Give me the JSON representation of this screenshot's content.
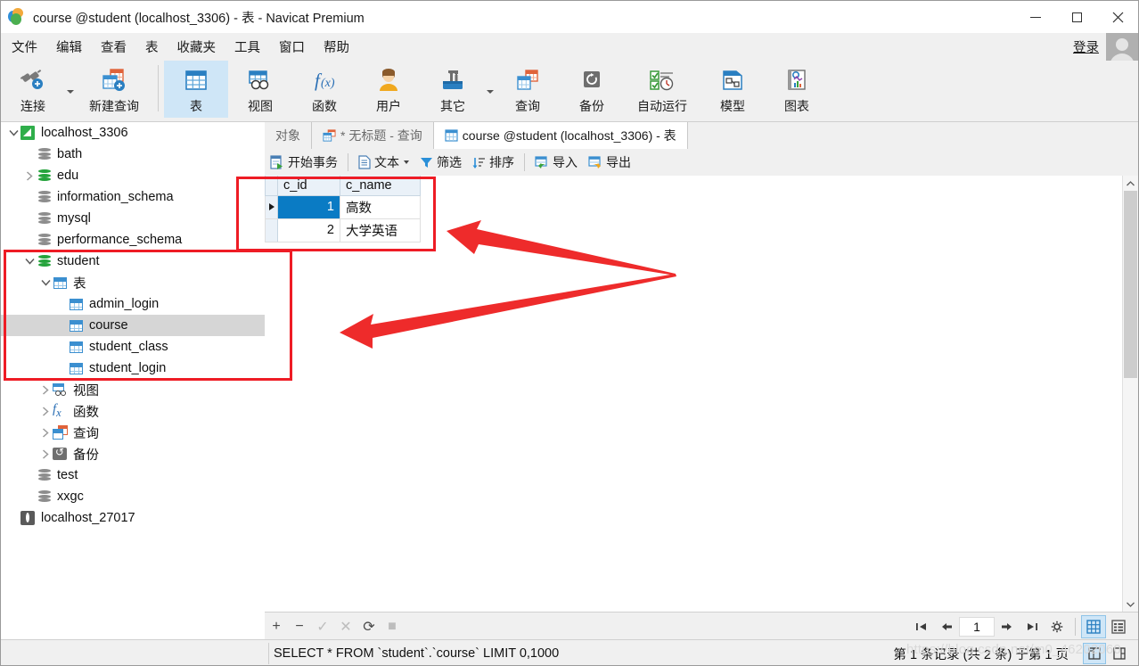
{
  "window": {
    "title": "course @student (localhost_3306) - 表 - Navicat Premium",
    "app_icon": "navicat-logo-icon",
    "controls": {
      "minimize": "minimize-icon",
      "maximize": "maximize-icon",
      "close": "close-icon"
    }
  },
  "menubar": {
    "items": [
      "文件",
      "编辑",
      "查看",
      "表",
      "收藏夹",
      "工具",
      "窗口",
      "帮助"
    ],
    "login_label": "登录",
    "avatar": "user-avatar-icon"
  },
  "ribbon": {
    "buttons": [
      {
        "label": "连接",
        "icon": "connection-icon",
        "has_caret": true,
        "selected": false
      },
      {
        "label": "新建查询",
        "icon": "new-query-icon",
        "has_caret": false,
        "selected": false
      },
      {
        "label": "表",
        "icon": "table-icon",
        "has_caret": false,
        "selected": true
      },
      {
        "label": "视图",
        "icon": "view-icon",
        "has_caret": false,
        "selected": false
      },
      {
        "label": "函数",
        "icon": "function-fx-icon",
        "has_caret": false,
        "selected": false
      },
      {
        "label": "用户",
        "icon": "user-icon",
        "has_caret": false,
        "selected": false
      },
      {
        "label": "其它",
        "icon": "others-toolbox-icon",
        "has_caret": true,
        "selected": false
      },
      {
        "label": "查询",
        "icon": "query-icon",
        "has_caret": false,
        "selected": false
      },
      {
        "label": "备份",
        "icon": "backup-icon",
        "has_caret": false,
        "selected": false
      },
      {
        "label": "自动运行",
        "icon": "automation-icon",
        "has_caret": false,
        "selected": false
      },
      {
        "label": "模型",
        "icon": "model-icon",
        "has_caret": false,
        "selected": false
      },
      {
        "label": "图表",
        "icon": "chart-icon",
        "has_caret": false,
        "selected": false
      }
    ]
  },
  "sidebar": {
    "items": [
      {
        "label": "localhost_3306",
        "indent": 0,
        "twisty": "down",
        "icon": "server-mysql-icon",
        "active": false
      },
      {
        "label": "bath",
        "indent": 1,
        "twisty": "none",
        "icon": "database-gray-icon",
        "active": false
      },
      {
        "label": "edu",
        "indent": 1,
        "twisty": "right",
        "icon": "database-green-icon",
        "active": false
      },
      {
        "label": "information_schema",
        "indent": 1,
        "twisty": "none",
        "icon": "database-gray-icon",
        "active": false
      },
      {
        "label": "mysql",
        "indent": 1,
        "twisty": "none",
        "icon": "database-gray-icon",
        "active": false
      },
      {
        "label": "performance_schema",
        "indent": 1,
        "twisty": "none",
        "icon": "database-gray-icon",
        "active": false
      },
      {
        "label": "student",
        "indent": 1,
        "twisty": "down",
        "icon": "database-green-icon",
        "active": false
      },
      {
        "label": "表",
        "indent": 2,
        "twisty": "down",
        "icon": "table-folder-icon",
        "active": false
      },
      {
        "label": "admin_login",
        "indent": 3,
        "twisty": "none",
        "icon": "table-icon",
        "active": false
      },
      {
        "label": "course",
        "indent": 3,
        "twisty": "none",
        "icon": "table-icon",
        "active": true
      },
      {
        "label": "student_class",
        "indent": 3,
        "twisty": "none",
        "icon": "table-icon",
        "active": false
      },
      {
        "label": "student_login",
        "indent": 3,
        "twisty": "none",
        "icon": "table-icon",
        "active": false
      },
      {
        "label": "视图",
        "indent": 2,
        "twisty": "right",
        "icon": "view-folder-icon",
        "active": false
      },
      {
        "label": "函数",
        "indent": 2,
        "twisty": "right",
        "icon": "function-fx-icon",
        "active": false
      },
      {
        "label": "查询",
        "indent": 2,
        "twisty": "right",
        "icon": "query-folder-icon",
        "active": false
      },
      {
        "label": "备份",
        "indent": 2,
        "twisty": "right",
        "icon": "backup-folder-icon",
        "active": false
      },
      {
        "label": "test",
        "indent": 1,
        "twisty": "none",
        "icon": "database-gray-icon",
        "active": false
      },
      {
        "label": "xxgc",
        "indent": 1,
        "twisty": "none",
        "icon": "database-gray-icon",
        "active": false
      },
      {
        "label": "localhost_27017",
        "indent": 0,
        "twisty": "none",
        "icon": "server-mongodb-icon",
        "active": false
      }
    ]
  },
  "tabs": [
    {
      "label": "对象",
      "icon": "",
      "active": false
    },
    {
      "label": "* 无标题 - 查询",
      "icon": "query-icon",
      "active": false
    },
    {
      "label": "course @student (localhost_3306) - 表",
      "icon": "table-icon",
      "active": true
    }
  ],
  "grid_toolbar": [
    {
      "label": "开始事务",
      "icon": "transaction-icon",
      "caret": false
    },
    {
      "label": "文本",
      "icon": "text-icon",
      "caret": true
    },
    {
      "label": "筛选",
      "icon": "filter-funnel-icon",
      "caret": false
    },
    {
      "label": "排序",
      "icon": "sort-icon",
      "caret": false
    },
    {
      "label": "导入",
      "icon": "import-icon",
      "caret": false
    },
    {
      "label": "导出",
      "icon": "export-icon",
      "caret": false
    }
  ],
  "grid": {
    "columns": [
      "c_id",
      "c_name"
    ],
    "rows": [
      {
        "c_id": "1",
        "c_name": "高数",
        "selected": true
      },
      {
        "c_id": "2",
        "c_name": "大学英语",
        "selected": false
      }
    ]
  },
  "grid_footer": {
    "buttons": [
      {
        "icon": "add-record-icon",
        "label": "+",
        "disabled": false
      },
      {
        "icon": "remove-record-icon",
        "label": "−",
        "disabled": false
      },
      {
        "icon": "apply-check-icon",
        "label": "✓",
        "disabled": true
      },
      {
        "icon": "cancel-x-icon",
        "label": "✕",
        "disabled": true
      },
      {
        "icon": "refresh-icon",
        "label": "⟳",
        "disabled": false
      },
      {
        "icon": "stop-icon",
        "label": "■",
        "disabled": true
      }
    ],
    "pager": {
      "first": "first-page-icon",
      "prev": "prev-page-icon",
      "page_value": "1",
      "next": "next-page-icon",
      "last": "last-page-icon",
      "settings": "gear-icon"
    },
    "view_modes": [
      {
        "icon": "grid-view-icon",
        "selected": true
      },
      {
        "icon": "form-view-icon",
        "selected": false
      }
    ]
  },
  "statusbar": {
    "sql": "SELECT * FROM `student`.`course` LIMIT 0,1000",
    "record_info": "第 1 条记录 (共 2 条) 于第 1 页",
    "buttons": [
      {
        "icon": "grid-layout-icon",
        "selected": true
      },
      {
        "icon": "detail-layout-icon",
        "selected": false
      }
    ]
  },
  "watermark": "https://blog.csdn.net/m0_46202060",
  "annotations": {
    "color": "#ee1c25",
    "boxes": [
      {
        "name": "grid-highlight-box"
      },
      {
        "name": "tree-highlight-box"
      }
    ],
    "arrows": [
      {
        "name": "arrow-to-grid"
      },
      {
        "name": "arrow-to-tree"
      }
    ]
  }
}
